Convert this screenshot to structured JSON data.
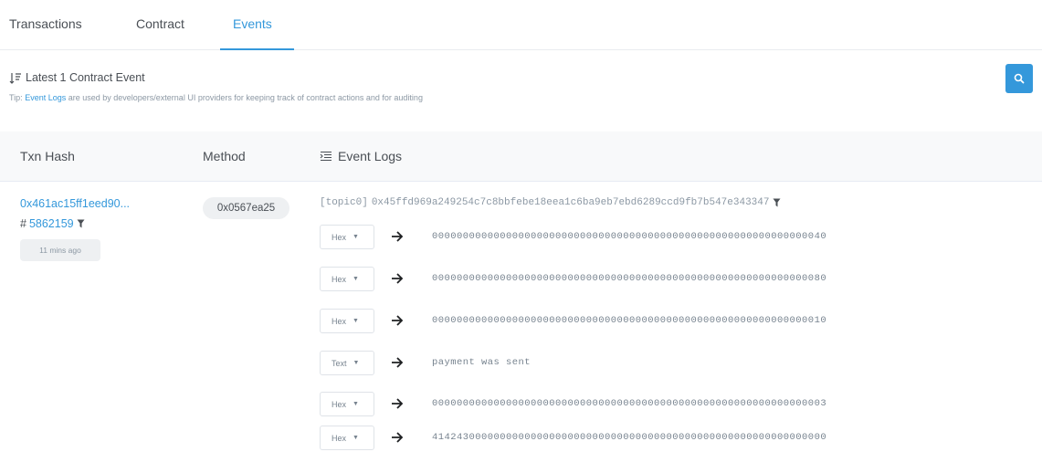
{
  "tabs": [
    {
      "label": "Transactions",
      "active": false
    },
    {
      "label": "Contract",
      "active": false
    },
    {
      "label": "Events",
      "active": true
    }
  ],
  "section": {
    "title": "Latest 1 Contract Event",
    "tip_prefix": "Tip:",
    "tip_link": "Event Logs",
    "tip_rest": "are used by developers/external UI providers for keeping track of contract actions and for auditing"
  },
  "table": {
    "headers": {
      "txn_hash": "Txn Hash",
      "method": "Method",
      "event_logs": "Event Logs"
    }
  },
  "event": {
    "txn_hash": "0x461ac15ff1eed90...",
    "block_prefix": "#",
    "block": "5862159",
    "age": "11 mins ago",
    "method": "0x0567ea25",
    "topic_label": "[topic0]",
    "topic_value": "0x45ffd969a249254c7c8bbfebe18eea1c6ba9eb7ebd6289ccd9fb7b547e343347",
    "logs": [
      {
        "format": "Hex",
        "value": "0000000000000000000000000000000000000000000000000000000000000040"
      },
      {
        "format": "Hex",
        "value": "0000000000000000000000000000000000000000000000000000000000000080"
      },
      {
        "format": "Hex",
        "value": "0000000000000000000000000000000000000000000000000000000000000010"
      },
      {
        "format": "Text",
        "value": "payment was sent"
      },
      {
        "format": "Hex",
        "value": "0000000000000000000000000000000000000000000000000000000000000003"
      },
      {
        "format": "Hex",
        "value": "4142430000000000000000000000000000000000000000000000000000000000"
      }
    ]
  },
  "colors": {
    "accent": "#3498db",
    "text": "#4a4f55",
    "muted": "#8c98a4"
  }
}
